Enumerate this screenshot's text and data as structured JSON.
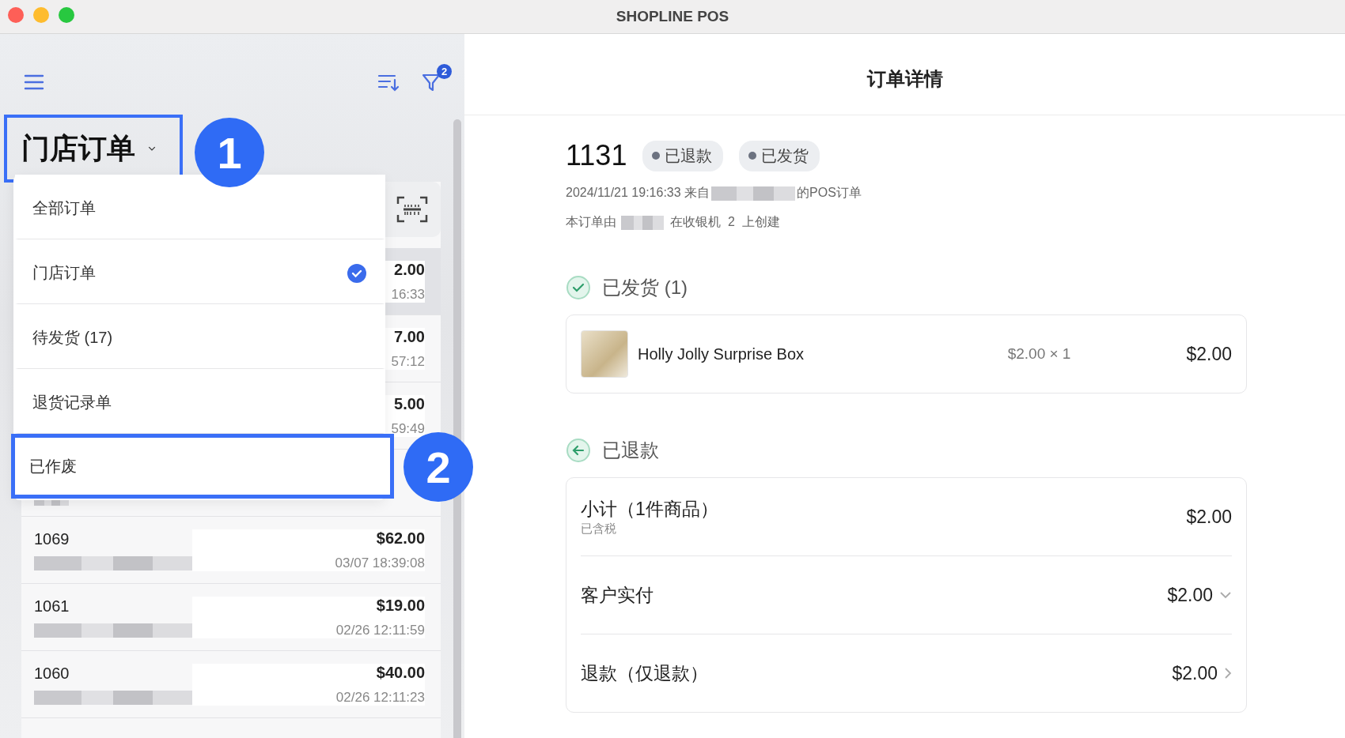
{
  "window": {
    "title": "SHOPLINE POS"
  },
  "sidebar": {
    "filter_badge": "2",
    "heading": {
      "label": "门店订单",
      "highlighted": true
    },
    "menu": [
      {
        "label": "全部订单",
        "selected": false,
        "highlighted": false
      },
      {
        "label": "门店订单",
        "selected": true,
        "highlighted": false
      },
      {
        "label": "待发货 (17)",
        "selected": false,
        "highlighted": false
      },
      {
        "label": "退货记录单",
        "selected": false,
        "highlighted": false
      },
      {
        "label": "已作废",
        "selected": false,
        "highlighted": true
      }
    ],
    "orders": [
      {
        "kind": "partial",
        "amount": "2.00",
        "time": "16:33",
        "selected": true
      },
      {
        "kind": "partial",
        "amount": "7.00",
        "time": "57:12",
        "selected": false
      },
      {
        "kind": "partial",
        "amount": "5.00",
        "time": "59:49",
        "selected": false
      },
      {
        "kind": "partial",
        "selected": false
      },
      {
        "kind": "full",
        "number": "1069",
        "amount": "$62.00",
        "time": "03/07 18:39:08",
        "selected": false
      },
      {
        "kind": "full",
        "number": "1061",
        "amount": "$19.00",
        "time": "02/26 12:11:59",
        "selected": false
      },
      {
        "kind": "full",
        "number": "1060",
        "amount": "$40.00",
        "time": "02/26 12:11:23",
        "selected": false
      }
    ]
  },
  "annotations": [
    {
      "number": "1"
    },
    {
      "number": "2"
    }
  ],
  "detail": {
    "header": "订单详情",
    "order_number": "1131",
    "badges": [
      "已退款",
      "已发货"
    ],
    "meta_1": {
      "before": "2024/11/21 19:16:33 来自",
      "after": "的POS订单"
    },
    "meta_2": {
      "before": "本订单由",
      "after": "在收银机  2  上创建"
    },
    "sections": [
      {
        "kind": "fulfilled",
        "title": "已发货 (1)",
        "items": [
          {
            "name": "Holly Jolly Surprise Box",
            "unit": "$2.00 × 1",
            "total": "$2.00"
          }
        ]
      },
      {
        "kind": "refunded",
        "title": "已退款",
        "summary": [
          {
            "kind": "plain",
            "label": "小计（1件商品）",
            "note": "已含税",
            "value": "$2.00"
          },
          {
            "kind": "expand",
            "label": "客户实付",
            "value": "$2.00"
          },
          {
            "kind": "link",
            "label": "退款（仅退款）",
            "value": "$2.00"
          }
        ]
      }
    ]
  }
}
